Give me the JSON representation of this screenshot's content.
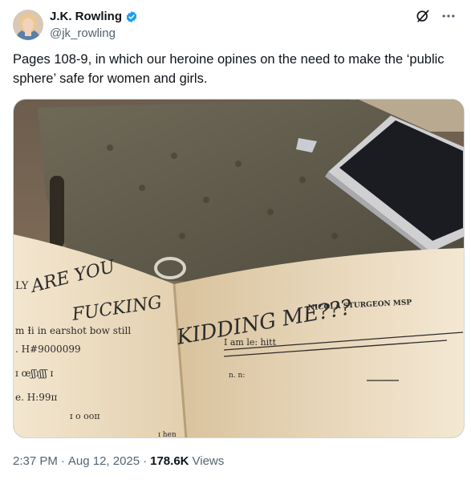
{
  "author": {
    "name": "J.K. Rowling",
    "handle": "@jk_rowling"
  },
  "post": {
    "text": "Pages 108-9, in which our heroine opines on the need to make the ‘public sphere’ safe for women and girls."
  },
  "image": {
    "left_page_lines": [
      "LY",
      "ARE YOU",
      "FUCKING",
      "m Ɨi in earshot bow still",
      ". H#9000099",
      "ɪ œʃʃɪʃʃʃ ɪ",
      "e. H:99ɪɪ",
      "ɪ o ooɪɪ",
      "ɪ hen"
    ],
    "right_page_lines": [
      "KIDDING ME???",
      "NICOLA STURGEON MSP",
      "I am le: hitt",
      "n. n:"
    ]
  },
  "footer": {
    "time": "2:37 PM",
    "date": "Aug 12, 2025",
    "separator": "·",
    "views_count": "178.6K",
    "views_label": "Views"
  },
  "colors": {
    "verified_blue": "#1d9bf0",
    "secondary_text": "#536471",
    "primary_text": "#0f1419"
  },
  "icons": {
    "verified": "verified-badge-icon",
    "grok": "grok-icon",
    "more": "more-icon"
  }
}
